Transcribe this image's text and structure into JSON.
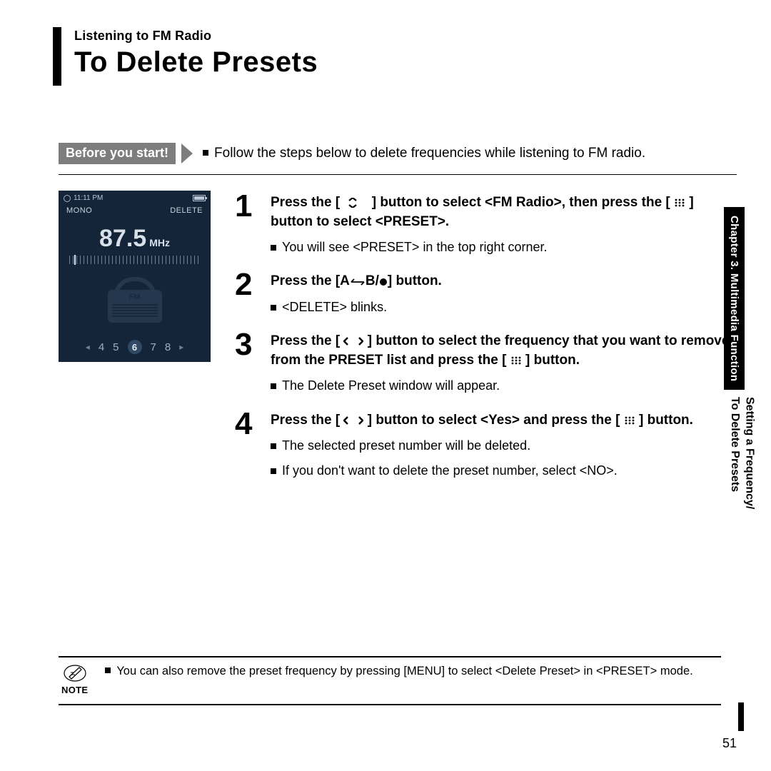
{
  "header": {
    "breadcrumb": "Listening to FM Radio",
    "title": "To Delete Presets"
  },
  "before": {
    "tag": "Before you start!",
    "text": "Follow the steps below to delete frequencies while listening to FM radio."
  },
  "device": {
    "time": "11:11 PM",
    "mode_left": "MONO",
    "mode_right": "DELETE",
    "frequency": "87.5",
    "freq_unit": "MHz",
    "fm_label": "FM",
    "presets": {
      "p1": "4",
      "p2": "5",
      "sel": "6",
      "p4": "7",
      "p5": "8"
    }
  },
  "steps": {
    "s1": {
      "num": "1",
      "head_a": "Press the [ ",
      "head_b": " ] button to select <FM Radio>, then press the [ ",
      "head_c": " ] button to select <PRESET>.",
      "sub1": "You will see <PRESET> in the top right corner."
    },
    "s2": {
      "num": "2",
      "head_a": "Press the [A",
      "head_b": "B/",
      "head_c": "] button.",
      "sub1": "<DELETE> blinks."
    },
    "s3": {
      "num": "3",
      "head_a": "Press the  [ ",
      "head_b": " ] button to select the frequency that you want to remove from the PRESET list and press the [ ",
      "head_c": " ] button.",
      "sub1": "The Delete Preset window will appear."
    },
    "s4": {
      "num": "4",
      "head_a": "Press the  [ ",
      "head_b": " ] button to select <Yes> and press the [ ",
      "head_c": " ] button.",
      "sub1": "The selected preset number will be deleted.",
      "sub2": "If you don't want to delete the preset number, select <NO>."
    }
  },
  "side": {
    "dark": "Chapter 3. Multimedia Function",
    "light1": "Setting a Frequency/",
    "light2": "To Delete Presets"
  },
  "note": {
    "label": "NOTE",
    "text": "You can also remove the preset frequency by pressing [MENU] to select <Delete Preset> in <PRESET> mode."
  },
  "page_number": "51"
}
